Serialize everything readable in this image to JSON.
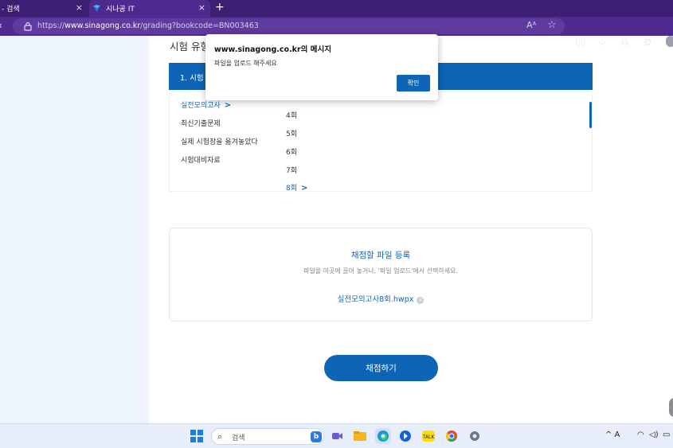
{
  "browser": {
    "tabs": [
      {
        "label": "- 검색",
        "active": false
      },
      {
        "label": "시나공 IT",
        "active": true
      }
    ],
    "new_tab_label": "+",
    "close_label": "×",
    "url_prefix": "https://",
    "url_domain": "www.sinagong.co.kr",
    "url_path": "/grading?bookcode=BN003463",
    "read_aloud_label": "Aᴬ"
  },
  "page": {
    "section_title": "시험 유형",
    "header_label": "1. 시험 유",
    "exam_types": [
      {
        "label": "실전모의고사",
        "active": true
      },
      {
        "label": "최신기출문제",
        "active": false
      },
      {
        "label": "실제 시험장을 옮겨놓았다",
        "active": false
      },
      {
        "label": "시험대비자료",
        "active": false
      }
    ],
    "rounds": [
      {
        "label": "4회",
        "active": false
      },
      {
        "label": "5회",
        "active": false
      },
      {
        "label": "6회",
        "active": false
      },
      {
        "label": "7회",
        "active": false
      },
      {
        "label": "8회",
        "active": true
      }
    ],
    "chevron": ">",
    "upload": {
      "title": "채점할 파일 등록",
      "description": "파일을 이곳에 끌어 놓거나, '파일 업로드'에서 선택하세요.",
      "file_name": "실전모의고사8회.hwpx"
    },
    "grade_button": "채점하기"
  },
  "dialog": {
    "title": "www.sinagong.co.kr의 메시지",
    "message": "파일을 업로드 해주세요",
    "ok_button": "확인"
  },
  "taskbar": {
    "search_placeholder": "검색",
    "tray_text": "^ A"
  },
  "colors": {
    "accent": "#0e64b5",
    "browser_frame": "#4e2a8e",
    "taskbar": "#e7eef9"
  }
}
